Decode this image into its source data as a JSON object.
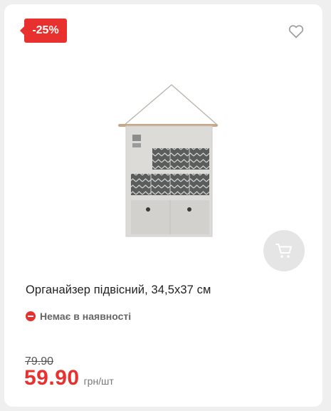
{
  "badge": {
    "discount": "-25%"
  },
  "icons": {
    "favorite": "heart-icon",
    "cart": "cart-icon",
    "stock": "minus-circle-icon"
  },
  "product": {
    "title": "Органайзер підвісний, 34,5x37 см",
    "availability": "Немає в наявності",
    "old_price": "79.90",
    "price": "59.90",
    "unit": "грн/шт"
  },
  "colors": {
    "accent": "#e8312e",
    "card_bg": "#ffffff",
    "page_bg": "#efefef",
    "cart_button_bg": "#e5e5e5"
  }
}
